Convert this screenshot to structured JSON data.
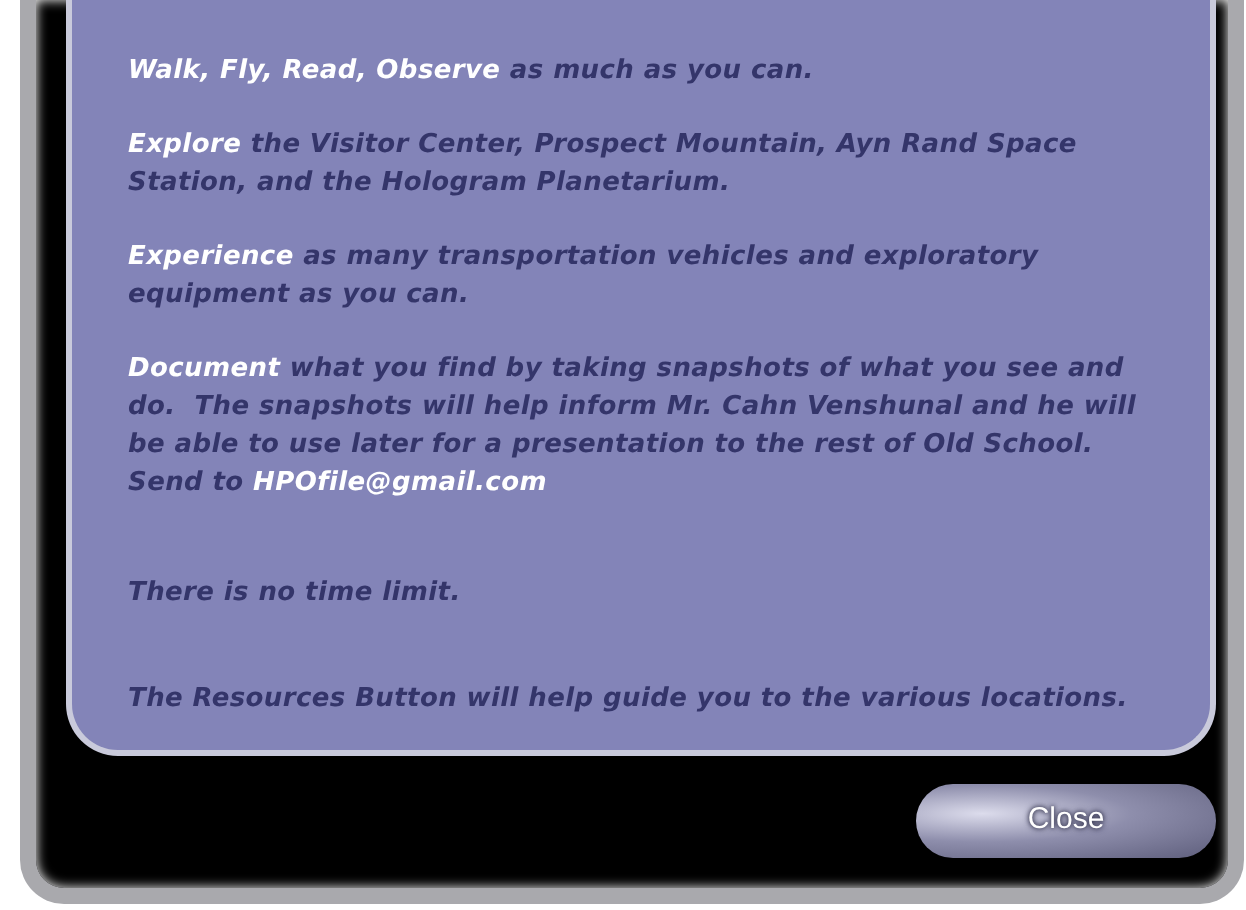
{
  "paragraphs": [
    {
      "segments": [
        {
          "text": "Walk, Fly, Read, Observe",
          "highlight": true
        },
        {
          "text": " as much as you can.",
          "highlight": false
        }
      ]
    },
    {
      "segments": [
        {
          "text": "Explore",
          "highlight": true
        },
        {
          "text": " the Visitor Center, Prospect Mountain, Ayn Rand Space Station, and the Hologram Planetarium.",
          "highlight": false
        }
      ]
    },
    {
      "segments": [
        {
          "text": "Experience",
          "highlight": true
        },
        {
          "text": " as many transportation vehicles and exploratory equipment as you can.",
          "highlight": false
        }
      ]
    },
    {
      "segments": [
        {
          "text": "Document",
          "highlight": true
        },
        {
          "text": " what you find by taking snapshots of what you see and do.  The snapshots will help inform Mr. Cahn Venshunal and he will be able to use later for a presentation to the rest of Old School. Send to ",
          "highlight": false
        },
        {
          "text": "HPOfile@gmail.com",
          "highlight": true
        }
      ]
    },
    {
      "segments": [
        {
          "text": "There is no time limit.",
          "highlight": false
        }
      ]
    },
    {
      "segments": [
        {
          "text": "The Resources Button will help guide you to the various locations.",
          "highlight": false
        }
      ]
    }
  ],
  "close_button": {
    "label": "Close"
  }
}
